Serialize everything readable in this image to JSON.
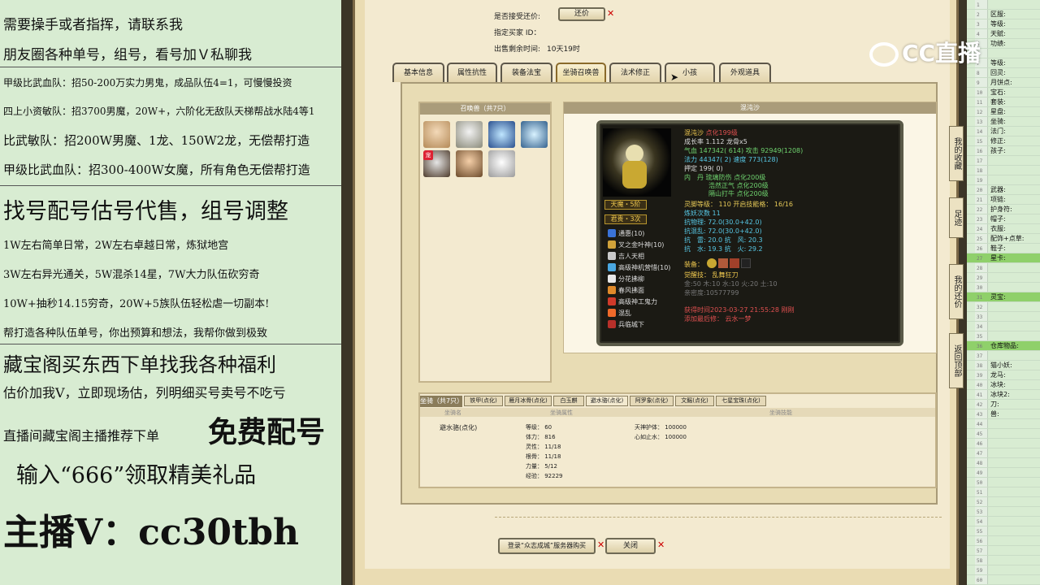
{
  "ad_lines": [
    "需要操手或者指挥，请联系我",
    "朋友圈各种单号，组号，看号加Ｖ私聊我",
    "甲级比武血队：招50-200万实力男鬼，成品队伍4=1，可慢慢投资",
    "四上小资敏队：招3700男魔，20W+，六阶化无敌队天梯帮战水陆4等1",
    "比武敏队：招200W男魔、1龙、150W2龙，无偿帮打造",
    "甲级比武血队：招300-400W女魔，所有角色无偿帮打造",
    "找号配号估号代售，组号调整",
    "1W左右简单日常，2W左右卓越日常，炼狱地宫",
    "3W左右异光通关，5W混杀14星，7W大力队伍砍穷奇",
    "10W+抽秒14.15穷奇，20W+5族队伍轻松虐一切副本!",
    "帮打造各种队伍单号，你出预算和想法，我帮你做到极致",
    "藏宝阁买东西下单找我各种福利",
    "估价加我V，立即现场估，列明细买号卖号不吃亏",
    "直播间藏宝阁主播推荐下单",
    "免费配号",
    "输入“666”领取精美礼品",
    "主播V：cc30tbh"
  ],
  "trade": {
    "accept_counter_label": "是否接受还价:",
    "counter_button": "还价",
    "buyer_id_label": "指定买家 ID：",
    "time_left_label": "出售剩余时间:",
    "time_left_value": "10天19时"
  },
  "tabs": [
    "基本信息",
    "属性抗性",
    "装备法宝",
    "坐骑召唤兽",
    "法术修正",
    "小孩",
    "外观道具"
  ],
  "pets": {
    "header": "召唤兽（共7只）",
    "thumb_badge": "宠"
  },
  "pet_detail": {
    "header": "混沌沙",
    "name": "混沌沙",
    "name_suffix": "点化199级",
    "growth": "成长率 1.112  龙骨x5",
    "hp": "气血 147342( 614)  攻击 92949(1208)",
    "mp": "法力 44347( 2)  速度 773(128)",
    "loyalty": "押定 199( 0)",
    "inner_dan_1": "内　丹 琉璃防伤 点化200级",
    "inner_dan_2": "浩然正气 点化200级",
    "inner_dan_3": "隔山打牛 点化200级",
    "badge1": "天魔・5阶",
    "badge2": "君贵・3次",
    "skills": [
      "通惠(10)",
      "叉之金叶神(10)",
      "吉人天相",
      "高级神机营惜(10)",
      "分花拂柳",
      "春风拂面",
      "高级神工鬼力",
      "混乱",
      "兵临城下"
    ],
    "spirit": "灵脚等级：  110  开启技能格：  16/16",
    "refine": "炼妖次数 11",
    "resist_phys": "抗物理: 72.0(30.0+42.0)",
    "resist_magic": "抗混乱: 72.0(30.0+42.0)",
    "resist_1": "抗　雷: 20.0  抗　风: 20.3",
    "resist_2": "抗　水: 19.3  抗　火: 29.2",
    "equip_label": "装备：",
    "awaken": "觉醒技：  乱舞狂刀",
    "elements": "金:50  木:10  水:10  火:20  土:10",
    "tianyuan": "亲密度:10577799",
    "date": "获得时间2023-03-27 21:55:28 刚刚",
    "owner_label": "添加最后修：  云水一梦"
  },
  "mounts": {
    "header": "坐骑（共7只）",
    "tabs": [
      "铁甲(点化)",
      "雁月冰骨(点化)",
      "白玉麒",
      "避水骆(点化)",
      "阿罗象(点化)",
      "文鳐(点化)",
      "七星宝珠(点化)"
    ],
    "col_name": "坐骑名",
    "col_attr": "坐骑属性",
    "col_skill": "坐骑技能",
    "name": "避水骆(点化)",
    "stats": [
      "等级：  60",
      "体力：  816",
      "灵性：  11/18",
      "根骨：  11/18",
      "力量：  5/12",
      "经验：  92229"
    ],
    "skills": [
      "天神护体：  100000",
      "心如止水：  100000"
    ]
  },
  "footer": {
    "login_button": "登录“众志成城”服务器购买",
    "close_button": "关闭"
  },
  "side_nav": [
    "我的收藏",
    "足迹",
    "我的还价",
    "返回顶部"
  ],
  "right_labels": [
    {
      "row": 1,
      "text": "区服:"
    },
    {
      "row": 2,
      "text": "等级:"
    },
    {
      "row": 3,
      "text": "天赋:"
    },
    {
      "row": 4,
      "text": "功绩:"
    },
    {
      "row": 6,
      "text": "等级:"
    },
    {
      "row": 7,
      "text": "回灵:"
    },
    {
      "row": 8,
      "text": "月饼点:"
    },
    {
      "row": 9,
      "text": "宝石:"
    },
    {
      "row": 10,
      "text": "套装:"
    },
    {
      "row": 11,
      "text": "星盘:"
    },
    {
      "row": 12,
      "text": "坐骑:"
    },
    {
      "row": 13,
      "text": "法门:"
    },
    {
      "row": 14,
      "text": "修正:"
    },
    {
      "row": 15,
      "text": "孩子:"
    },
    {
      "row": 19,
      "text": "武器:"
    },
    {
      "row": 20,
      "text": "项链:"
    },
    {
      "row": 21,
      "text": "护身符:"
    },
    {
      "row": 22,
      "text": "帽子:"
    },
    {
      "row": 23,
      "text": "衣服:"
    },
    {
      "row": 24,
      "text": "配饰+点草:"
    },
    {
      "row": 25,
      "text": "鞋子:"
    },
    {
      "row": 26,
      "text": "星卡:"
    },
    {
      "row": 30,
      "text": "灵宝:"
    },
    {
      "row": 35,
      "text": "仓库物品:"
    },
    {
      "row": 37,
      "text": "猫小妖:"
    },
    {
      "row": 38,
      "text": "龙马:"
    },
    {
      "row": 39,
      "text": "冰块:"
    },
    {
      "row": 40,
      "text": "冰块2:"
    },
    {
      "row": 41,
      "text": "刀:"
    },
    {
      "row": 42,
      "text": "兽:"
    }
  ],
  "right_row_numbers": [
    "1",
    "2",
    "3",
    "4",
    "5",
    "6",
    "7",
    "8",
    "9",
    "10",
    "11",
    "12",
    "13",
    "14",
    "15",
    "16",
    "17",
    "18",
    "19",
    "20",
    "21",
    "22",
    "23",
    "24",
    "25",
    "26",
    "27",
    "28",
    "29",
    "30",
    "31",
    "32",
    "33",
    "34",
    "35",
    "36",
    "37",
    "38",
    "39",
    "40",
    "41",
    "42",
    "43",
    "44",
    "45",
    "46",
    "47",
    "48",
    "49",
    "50",
    "51",
    "52",
    "53",
    "54",
    "55",
    "56",
    "57",
    "58",
    "59",
    "60"
  ],
  "logo_text": "CC直播",
  "colors": {
    "accent_green": "#8fd06a",
    "name_red": "#e05050",
    "stat_green": "#6fd36f",
    "stat_cyan": "#57c8e6",
    "stat_yellow": "#e6c957"
  }
}
